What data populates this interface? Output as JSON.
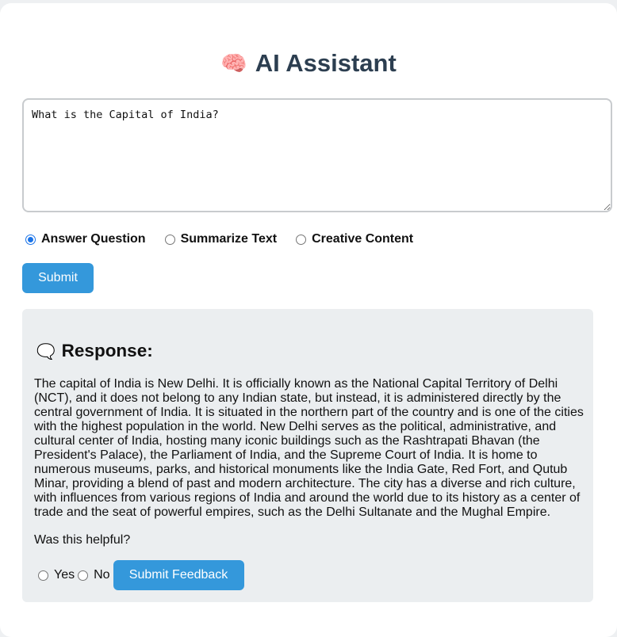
{
  "header": {
    "icon": "brain-icon",
    "title": "AI Assistant"
  },
  "prompt": {
    "value": "What is the Capital of India?"
  },
  "modes": {
    "selected": "Answer Question",
    "options": [
      "Answer Question",
      "Summarize Text",
      "Creative Content"
    ]
  },
  "actions": {
    "submit_label": "Submit"
  },
  "response": {
    "icon": "speech-bubble-icon",
    "title": "Response:",
    "text": "The capital of India is New Delhi. It is officially known as the National Capital Territory of Delhi (NCT), and it does not belong to any Indian state, but instead, it is administered directly by the central government of India. It is situated in the northern part of the country and is one of the cities with the highest population in the world. New Delhi serves as the political, administrative, and cultural center of India, hosting many iconic buildings such as the Rashtrapati Bhavan (the President's Palace), the Parliament of India, and the Supreme Court of India. It is home to numerous museums, parks, and historical monuments like the India Gate, Red Fort, and Qutub Minar, providing a blend of past and modern architecture. The city has a diverse and rich culture, with influences from various regions of India and around the world due to its history as a center of trade and the seat of powerful empires, such as the Delhi Sultanate and the Mughal Empire."
  },
  "feedback": {
    "question": "Was this helpful?",
    "yes_label": "Yes",
    "no_label": "No",
    "submit_label": "Submit Feedback"
  },
  "colors": {
    "accent": "#3498db",
    "title": "#2c3e50",
    "panel": "#ebeef0"
  }
}
